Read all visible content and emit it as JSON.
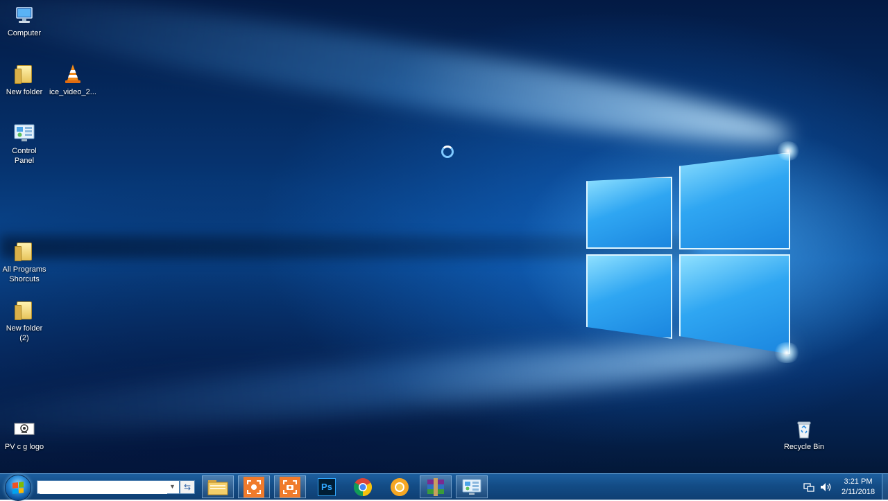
{
  "desktop": {
    "icons": [
      {
        "label": "Computer"
      },
      {
        "label": "New folder"
      },
      {
        "label": "ice_video_2..."
      },
      {
        "label": "Control\nPanel"
      },
      {
        "label": "All Programs\nShorcuts"
      },
      {
        "label": "New folder\n(2)"
      },
      {
        "label": "PV c g logo"
      },
      {
        "label": "Recycle Bin"
      }
    ]
  },
  "taskbar": {
    "search": {
      "value": "",
      "placeholder": ""
    },
    "pinned": [
      {
        "name": "File Explorer",
        "icon": "folder-icon"
      },
      {
        "name": "Screen recorder",
        "icon": "screen-recorder-icon"
      },
      {
        "name": "Screenshot tool",
        "icon": "camera-icon"
      },
      {
        "name": "Photoshop",
        "icon": "photoshop-icon",
        "text": "Ps"
      },
      {
        "name": "Google Chrome",
        "icon": "chrome-icon"
      },
      {
        "name": "Chrome Canary",
        "icon": "canary-icon"
      },
      {
        "name": "WinRAR",
        "icon": "winrar-icon"
      },
      {
        "name": "Control Panel",
        "icon": "control-panel-icon"
      }
    ],
    "clock": {
      "time": "3:21 PM",
      "date": "2/11/2018"
    }
  },
  "colors": {
    "taskbar": "#134c86",
    "accent": "#2fa6f2",
    "orange": "#f07b2c"
  }
}
